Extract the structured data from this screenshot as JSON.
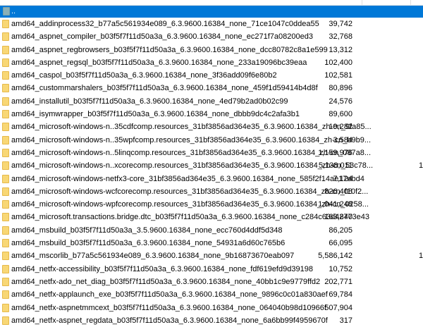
{
  "parent": {
    "label": ".."
  },
  "files": [
    {
      "name": "amd64_addinprocess32_b77a5c561934e089_6.3.9600.16384_none_71ce1047c0ddea55",
      "size": "39,742",
      "extra": ""
    },
    {
      "name": "amd64_aspnet_compiler_b03f5f7f11d50a3a_6.3.9600.16384_none_ec271f7a08200ed3",
      "size": "32,768",
      "extra": ""
    },
    {
      "name": "amd64_aspnet_regbrowsers_b03f5f7f11d50a3a_6.3.9600.16384_none_dcc80782c8a1e599",
      "size": "13,312",
      "extra": ""
    },
    {
      "name": "amd64_aspnet_regsql_b03f5f7f11d50a3a_6.3.9600.16384_none_233a19096bc39eaa",
      "size": "102,400",
      "extra": ""
    },
    {
      "name": "amd64_caspol_b03f5f7f11d50a3a_6.3.9600.16384_none_3f36add09f6e80b2",
      "size": "102,581",
      "extra": ""
    },
    {
      "name": "amd64_custommarshalers_b03f5f7f11d50a3a_6.3.9600.16384_none_459f1d59414b4d8f",
      "size": "80,896",
      "extra": ""
    },
    {
      "name": "amd64_installutil_b03f5f7f11d50a3a_6.3.9600.16384_none_4ed79b2ad0b02c99",
      "size": "24,576",
      "extra": ""
    },
    {
      "name": "amd64_isymwrapper_b03f5f7f11d50a3a_6.3.9600.16384_none_dbbb9dc4c2afa3b1",
      "size": "89,600",
      "extra": ""
    },
    {
      "name": "amd64_microsoft-windows-n..35cdfcomp.resources_31bf3856ad364e35_6.3.9600.16384_zh-cn_9fa85...",
      "size": "19,282",
      "extra": ""
    },
    {
      "name": "amd64_microsoft-windows-n..35wpfcomp.resources_31bf3856ad364e35_6.3.9600.16384_zh-cn_b9b9...",
      "size": "3,584",
      "extra": ""
    },
    {
      "name": "amd64_microsoft-windows-n..5linqcomp.resources_31bf3856ad364e35_6.3.9600.16384_zh-cn_087a8...",
      "size": "1,159,976",
      "extra": ""
    },
    {
      "name": "amd64_microsoft-windows-n..xcorecomp.resources_31bf3856ad364e35_6.3.9600.16384_zh-cn_53c78...",
      "size": "5,138,011",
      "extra": "1"
    },
    {
      "name": "amd64_microsoft-windows-netfx3-core_31bf3856ad364e35_6.3.9600.16384_none_585f2f14ae17ebd4",
      "size": "7,124",
      "extra": ""
    },
    {
      "name": "amd64_microsoft-windows-wcfcorecomp.resources_31bf3856ad364e35_6.3.9600.16384_zh-cn_f10f2...",
      "size": "826,408",
      "extra": ""
    },
    {
      "name": "amd64_microsoft-windows-wpfcorecomp.resources_31bf3856ad364e35_6.3.9600.16384_zh-cn_0258...",
      "size": "1,041,248",
      "extra": ""
    },
    {
      "name": "amd64_microsoft.transactions.bridge.dtc_b03f5f7f11d50a3a_6.3.9600.16384_none_c284c63d42773e43",
      "size": "163,840",
      "extra": ""
    },
    {
      "name": "amd64_msbuild_b03f5f7f11d50a3a_3.5.9600.16384_none_ecc760d4ddf5d348",
      "size": "86,205",
      "extra": ""
    },
    {
      "name": "amd64_msbuild_b03f5f7f11d50a3a_6.3.9600.16384_none_54931a6d60c765b6",
      "size": "66,095",
      "extra": ""
    },
    {
      "name": "amd64_mscorlib_b77a5c561934e089_6.3.9600.16384_none_9b16873670eab097",
      "size": "5,586,142",
      "extra": "1"
    },
    {
      "name": "amd64_netfx-accessibility_b03f5f7f11d50a3a_6.3.9600.16384_none_fdf619efd9d39198",
      "size": "10,752",
      "extra": ""
    },
    {
      "name": "amd64_netfx-ado_net_diag_b03f5f7f11d50a3a_6.3.9600.16384_none_40bb1c9e9779ffd2",
      "size": "202,771",
      "extra": ""
    },
    {
      "name": "amd64_netfx-applaunch_exe_b03f5f7f11d50a3a_6.3.9600.16384_none_9896c0c01a830aef",
      "size": "69,784",
      "extra": ""
    },
    {
      "name": "amd64_netfx-aspnetmmcext_b03f5f7f11d50a3a_6.3.9600.16384_none_064040b98d10966f",
      "size": "507,904",
      "extra": ""
    },
    {
      "name": "amd64_netfx-aspnet_regdata_b03f5f7f11d50a3a_6.3.9600.16384_none_6a6bb99f4959670f",
      "size": "317",
      "extra": ""
    }
  ]
}
